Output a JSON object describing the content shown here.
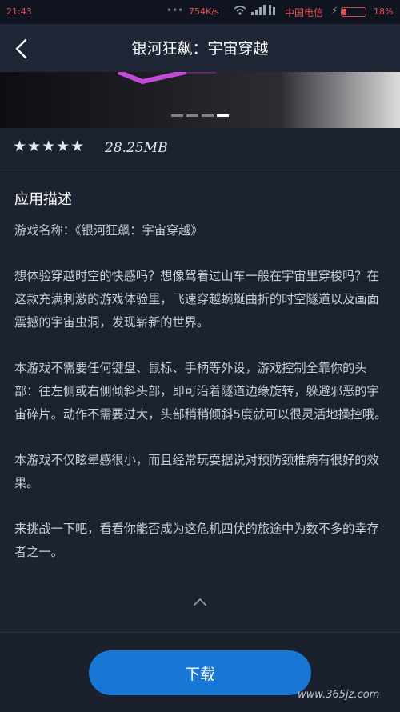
{
  "status_bar": {
    "time": "21:43",
    "speed": "754K/s",
    "carrier": "中国电信",
    "battery_percent": "18%",
    "battery_level": 0.18,
    "icons": [
      "dots-icon",
      "wifi-icon",
      "signal-icon",
      "charging-icon",
      "battery-icon"
    ]
  },
  "header": {
    "title": "银河狂飙：宇宙穿越",
    "back_icon": "chevron-left-icon"
  },
  "banner": {
    "dots_count": 4,
    "active_dot": 3,
    "accent_color": "#c34bd6"
  },
  "info": {
    "rating_stars": "★★★★★",
    "rating_value": 5,
    "size": "28.25MB"
  },
  "description": {
    "title": "应用描述",
    "paragraphs": [
      "游戏名称：《银河狂飙：宇宙穿越》",
      "想体验穿越时空的快感吗？想像驾着过山车一般在宇宙里穿梭吗？在这款充满刺激的游戏体验里，飞速穿越蜿蜒曲折的时空隧道以及画面震撼的宇宙虫洞，发现崭新的世界。",
      "本游戏不需要任何键盘、鼠标、手柄等外设，游戏控制全靠你的头部：往左侧或右侧倾斜头部，即可沿着隧道边缘旋转，躲避邪恶的宇宙碎片。动作不需要过大，头部稍稍倾斜5度就可以很灵活地操控哦。",
      "本游戏不仅眩晕感很小，而且经常玩耍据说对预防颈椎病有很好的效果。",
      "来挑战一下吧，看看你能否成为这危机四伏的旅途中为数不多的幸存者之一。"
    ],
    "collapse_icon": "chevron-up-icon"
  },
  "footer": {
    "download_label": "下载",
    "button_color": "#1877d4",
    "watermark": "www.365jz.com"
  }
}
